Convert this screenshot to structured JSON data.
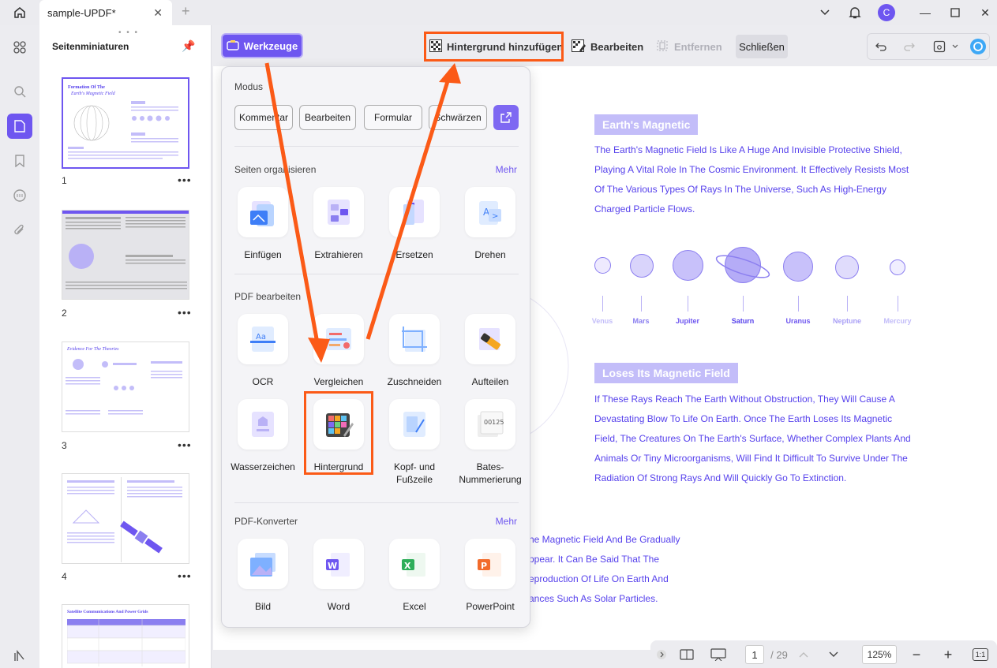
{
  "titlebar": {
    "tab_title": "sample-UPDF*",
    "avatar_letter": "C"
  },
  "thumbnails": {
    "title": "Seitenminiaturen",
    "pages": [
      "1",
      "2",
      "3",
      "4"
    ],
    "page1": {
      "heading": "Formation Of The",
      "subheading": "Earth's Magnetic Field"
    },
    "page3": {
      "heading": "Evidence For The Theories"
    },
    "page5": {
      "heading": "Satellite Communications And Power Grids"
    }
  },
  "toolbar": {
    "tools_label": "Werkzeuge",
    "add_background": "Hintergrund hinzufügen",
    "edit": "Bearbeiten",
    "remove": "Entfernen",
    "close": "Schließen"
  },
  "popup": {
    "mode_title": "Modus",
    "modes": [
      "Kommentar",
      "Bearbeiten",
      "Formular",
      "Schwärzen"
    ],
    "organize_title": "Seiten organisieren",
    "organize_more": "Mehr",
    "organize_tools": [
      "Einfügen",
      "Extrahieren",
      "Ersetzen",
      "Drehen"
    ],
    "edit_title": "PDF bearbeiten",
    "edit_tools": [
      "OCR",
      "Vergleichen",
      "Zuschneiden",
      "Aufteilen",
      "Wasserzeichen",
      "Hintergrund",
      "Kopf- und Fußzeile",
      "Bates-Nummerierung"
    ],
    "converter_title": "PDF-Konverter",
    "converter_more": "Mehr",
    "converter_tools": [
      "Bild",
      "Word",
      "Excel",
      "PowerPoint"
    ]
  },
  "document": {
    "heading1": "Earth's Magnetic",
    "para1": [
      "The Earth's Magnetic Field Is Like A Huge And Invisible Protective Shield,",
      "Playing A Vital Role In The Cosmic Environment. It Effectively Resists Most",
      "Of The Various Types Of Rays In The Universe, Such As High-Energy",
      "Charged Particle Flows."
    ],
    "planets": [
      "Venus",
      "Mars",
      "Jupiter",
      "Saturn",
      "Uranus",
      "Neptune",
      "Mercury"
    ],
    "heading2": "Loses Its Magnetic Field",
    "para2": [
      "If These Rays Reach The Earth Without Obstruction, They Will Cause A",
      "Devastating Blow To Life On Earth. Once The Earth Loses Its Magnetic",
      "Field, The Creatures On The Earth's Surface, Whether Complex Plants And",
      "Animals Or Tiny Microorganisms, Will Find It Difficult To Survive Under The",
      "Radiation Of Strong Rays And Will Quickly Go To Extinction."
    ],
    "para3": [
      "he Magnetic Field And Be Gradually",
      "ppear. It Can Be Said That The",
      "eproduction Of Life On Earth And",
      "ances Such As Solar Particles."
    ]
  },
  "bottom_nav": {
    "current_page": "1",
    "total_pages": "/ 29",
    "zoom": "125%",
    "fit": "1:1"
  },
  "colors": {
    "accent": "#6e56f0",
    "annotation": "#fb5a17",
    "doc_text": "#5641ec"
  }
}
